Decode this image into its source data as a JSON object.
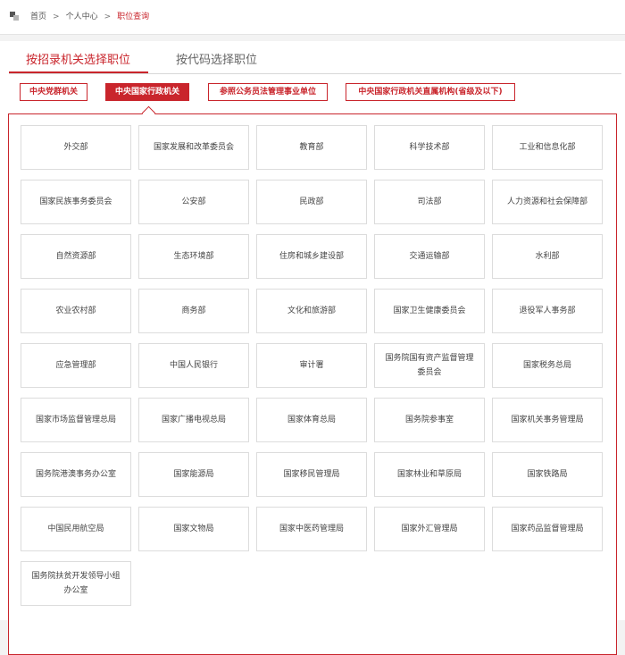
{
  "breadcrumb": {
    "items": [
      "首页",
      "个人中心"
    ],
    "separator": ">",
    "current": "职位查询"
  },
  "tabs": {
    "active": "按招录机关选择职位",
    "inactive": "按代码选择职位"
  },
  "categories": [
    {
      "label": "中央党群机关",
      "active": false
    },
    {
      "label": "中央国家行政机关",
      "active": true
    },
    {
      "label": "参照公务员法管理事业单位",
      "active": false
    },
    {
      "label": "中央国家行政机关直属机构(省级及以下)",
      "active": false
    }
  ],
  "agencies": [
    "外交部",
    "国家发展和改革委员会",
    "教育部",
    "科学技术部",
    "工业和信息化部",
    "国家民族事务委员会",
    "公安部",
    "民政部",
    "司法部",
    "人力资源和社会保障部",
    "自然资源部",
    "生态环境部",
    "住房和城乡建设部",
    "交通运输部",
    "水利部",
    "农业农村部",
    "商务部",
    "文化和旅游部",
    "国家卫生健康委员会",
    "退役军人事务部",
    "应急管理部",
    "中国人民银行",
    "审计署",
    "国务院国有资产监督管理委员会",
    "国家税务总局",
    "国家市场监督管理总局",
    "国家广播电视总局",
    "国家体育总局",
    "国务院参事室",
    "国家机关事务管理局",
    "国务院港澳事务办公室",
    "国家能源局",
    "国家移民管理局",
    "国家林业和草原局",
    "国家铁路局",
    "中国民用航空局",
    "国家文物局",
    "国家中医药管理局",
    "国家外汇管理局",
    "国家药品监督管理局",
    "国务院扶贫开发领导小组办公室"
  ],
  "colors": {
    "accent": "#c9252c",
    "background": "#f3f3f3"
  }
}
